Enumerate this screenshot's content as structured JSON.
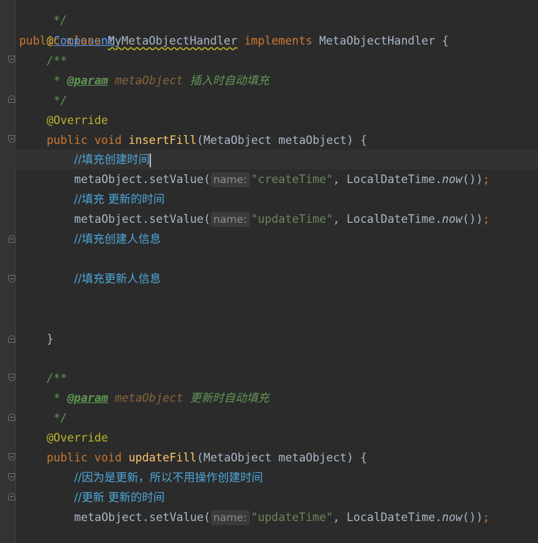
{
  "editor": {
    "lines": [
      {
        "text": " */"
      },
      {
        "anno_at": "@",
        "anno_name": "Component"
      },
      {
        "kw1": "public",
        "kw2": "class",
        "class_name": "MyMetaObjectHandler",
        "kw3": "implements",
        "iface": "MetaObjectHandler",
        "brace": "{"
      },
      {
        "text": "/**"
      },
      {
        "star": "*",
        "tag": "@param",
        "name": "metaObject",
        "desc": "插入时自动填充"
      },
      {
        "text": "*/"
      },
      {
        "text": "@Override"
      },
      {
        "kw1": "public",
        "kw2": "void",
        "method": "insertFill",
        "params": "(MetaObject metaObject) {"
      },
      {
        "text": "//填充创建时间"
      },
      {
        "obj": "metaObject.setValue(",
        "hint": "name:",
        "str": "\"createTime\"",
        "rest1": ", LocalDateTime.",
        "call": "now",
        "rest2": "())",
        "semi": ";"
      },
      {
        "text": "//填充 更新的时间"
      },
      {
        "obj": "metaObject.setValue(",
        "hint": "name:",
        "str": "\"updateTime\"",
        "rest1": ", LocalDateTime.",
        "call": "now",
        "rest2": "())",
        "semi": ";"
      },
      {
        "text": "//填充创建人信息"
      },
      {
        "text": "//填充更新人信息"
      },
      {
        "text": "}"
      },
      {
        "text": "/**"
      },
      {
        "star": "*",
        "tag": "@param",
        "name": "metaObject",
        "desc": "更新时自动填充"
      },
      {
        "text": "*/"
      },
      {
        "text": "@Override"
      },
      {
        "kw1": "public",
        "kw2": "void",
        "method": "updateFill",
        "params": "(MetaObject metaObject) {"
      },
      {
        "text": "//因为是更新，所以不用操作创建时间"
      },
      {
        "text": "//更新 更新的时间"
      },
      {
        "obj": "metaObject.setValue(",
        "hint": "name:",
        "str": "\"updateTime\"",
        "rest1": ", LocalDateTime.",
        "call": "now",
        "rest2": "())",
        "semi": ";"
      }
    ]
  },
  "colors": {
    "background": "#2b2b2b",
    "keyword": "#cc7832",
    "annotation": "#bbb529",
    "method": "#ffc66d",
    "string": "#6a8759",
    "line_comment": "#4ea7d8",
    "doc_comment": "#629755"
  }
}
